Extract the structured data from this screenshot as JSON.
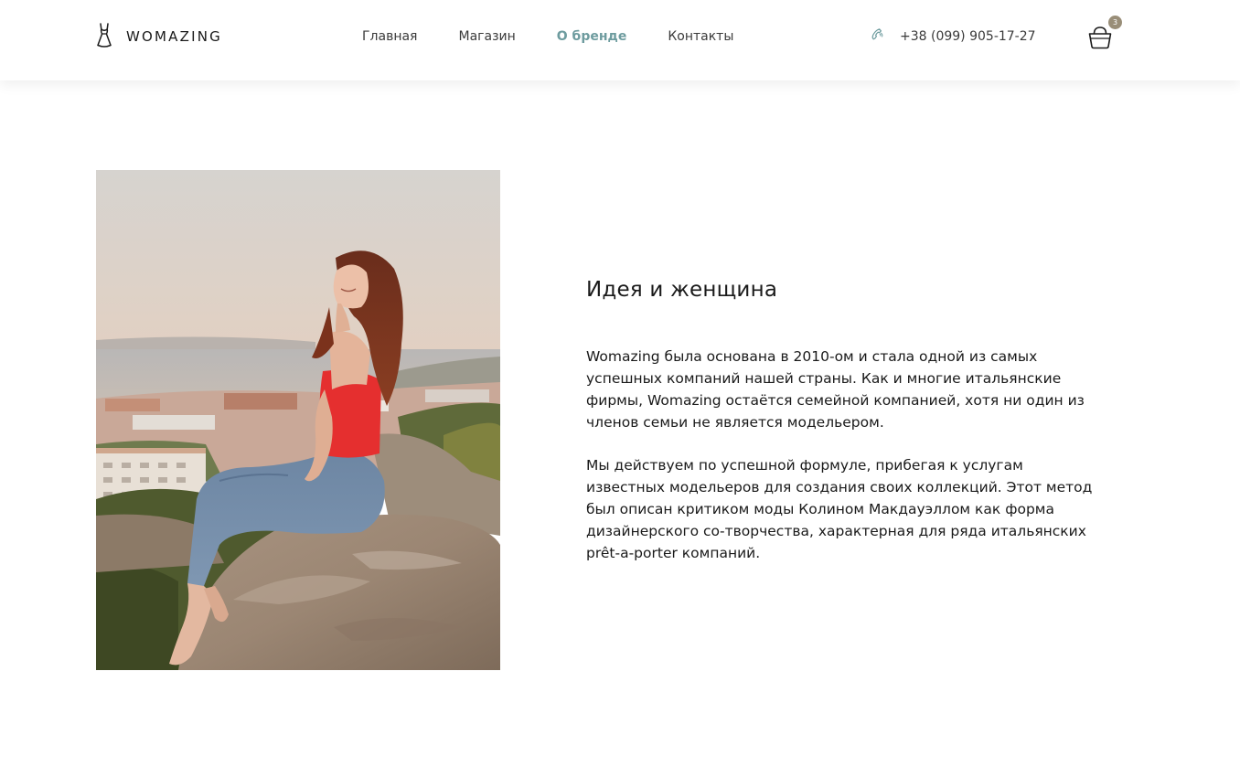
{
  "header": {
    "logo_text": "WOMAZING",
    "nav": [
      {
        "label": "Главная",
        "active": false
      },
      {
        "label": "Магазин",
        "active": false
      },
      {
        "label": "О бренде",
        "active": true
      },
      {
        "label": "Контакты",
        "active": false
      }
    ],
    "phone": "+38 (099) 905-17-27",
    "cart_count": "3"
  },
  "main": {
    "title": "Идея и женщина",
    "paragraph_1": "Womazing была основана в 2010-ом и стала одной из самых успешных компаний нашей страны. Как и многие итальянские фирмы, Womazing остаётся семейной компанией, хотя ни один из членов семьи не является модельером.",
    "paragraph_2": "Мы действуем по успешной формуле, прибегая к услугам известных модельеров для создания своих коллекций. Этот метод был описан критиком моды Колином Макдауэллом как форма дизайнерского со-творчества, характерная для ряда итальянских prêt-a-porter компаний."
  },
  "colors": {
    "accent": "#6e9c9f",
    "badge": "#998e78",
    "text": "#1a1a1a"
  },
  "icons": {
    "logo": "dress-icon",
    "phone": "phone-icon",
    "cart": "shopping-basket-icon"
  }
}
